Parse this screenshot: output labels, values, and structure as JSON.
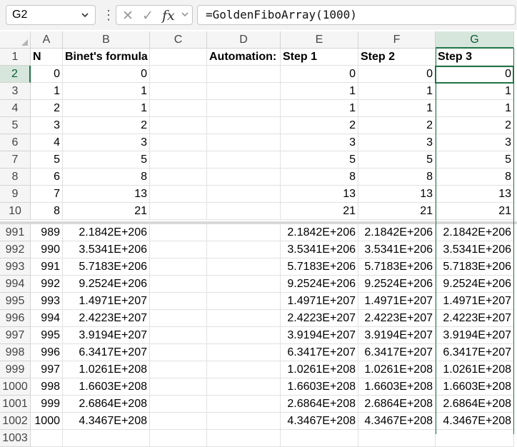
{
  "formula_bar": {
    "name_box": "G2",
    "cancel_glyph": "✕",
    "enter_glyph": "✓",
    "fx_label": "fx",
    "formula": "=GoldenFiboArray(1000)"
  },
  "icons": {
    "name_box_dropdown": "chevron-down-icon",
    "more_options": "vertical-dots-icon",
    "cancel": "close-icon",
    "enter": "check-icon",
    "insert_function": "fx-icon"
  },
  "colors": {
    "selection_green": "#217346",
    "header_bg": "#f5f5f5"
  },
  "columns": [
    "A",
    "B",
    "C",
    "D",
    "E",
    "F",
    "G"
  ],
  "selected_column": "G",
  "active_cell": "G2",
  "header_row": {
    "row": "1",
    "cells": [
      "N",
      "Binet's formula",
      "",
      "Automation:",
      "Step 1",
      "Step 2",
      "Step 3"
    ]
  },
  "top_rows": [
    {
      "row": "2",
      "cells": [
        "0",
        "0",
        "",
        "",
        "0",
        "0",
        "0"
      ]
    },
    {
      "row": "3",
      "cells": [
        "1",
        "1",
        "",
        "",
        "1",
        "1",
        "1"
      ]
    },
    {
      "row": "4",
      "cells": [
        "2",
        "1",
        "",
        "",
        "1",
        "1",
        "1"
      ]
    },
    {
      "row": "5",
      "cells": [
        "3",
        "2",
        "",
        "",
        "2",
        "2",
        "2"
      ]
    },
    {
      "row": "6",
      "cells": [
        "4",
        "3",
        "",
        "",
        "3",
        "3",
        "3"
      ]
    },
    {
      "row": "7",
      "cells": [
        "5",
        "5",
        "",
        "",
        "5",
        "5",
        "5"
      ]
    },
    {
      "row": "8",
      "cells": [
        "6",
        "8",
        "",
        "",
        "8",
        "8",
        "8"
      ]
    },
    {
      "row": "9",
      "cells": [
        "7",
        "13",
        "",
        "",
        "13",
        "13",
        "13"
      ]
    },
    {
      "row": "10",
      "cells": [
        "8",
        "21",
        "",
        "",
        "21",
        "21",
        "21"
      ]
    }
  ],
  "bottom_rows": [
    {
      "row": "991",
      "cells": [
        "989",
        "2.1842E+206",
        "",
        "",
        "2.1842E+206",
        "2.1842E+206",
        "2.1842E+206"
      ]
    },
    {
      "row": "992",
      "cells": [
        "990",
        "3.5341E+206",
        "",
        "",
        "3.5341E+206",
        "3.5341E+206",
        "3.5341E+206"
      ]
    },
    {
      "row": "993",
      "cells": [
        "991",
        "5.7183E+206",
        "",
        "",
        "5.7183E+206",
        "5.7183E+206",
        "5.7183E+206"
      ]
    },
    {
      "row": "994",
      "cells": [
        "992",
        "9.2524E+206",
        "",
        "",
        "9.2524E+206",
        "9.2524E+206",
        "9.2524E+206"
      ]
    },
    {
      "row": "995",
      "cells": [
        "993",
        "1.4971E+207",
        "",
        "",
        "1.4971E+207",
        "1.4971E+207",
        "1.4971E+207"
      ]
    },
    {
      "row": "996",
      "cells": [
        "994",
        "2.4223E+207",
        "",
        "",
        "2.4223E+207",
        "2.4223E+207",
        "2.4223E+207"
      ]
    },
    {
      "row": "997",
      "cells": [
        "995",
        "3.9194E+207",
        "",
        "",
        "3.9194E+207",
        "3.9194E+207",
        "3.9194E+207"
      ]
    },
    {
      "row": "998",
      "cells": [
        "996",
        "6.3417E+207",
        "",
        "",
        "6.3417E+207",
        "6.3417E+207",
        "6.3417E+207"
      ]
    },
    {
      "row": "999",
      "cells": [
        "997",
        "1.0261E+208",
        "",
        "",
        "1.0261E+208",
        "1.0261E+208",
        "1.0261E+208"
      ]
    },
    {
      "row": "1000",
      "cells": [
        "998",
        "1.6603E+208",
        "",
        "",
        "1.6603E+208",
        "1.6603E+208",
        "1.6603E+208"
      ]
    },
    {
      "row": "1001",
      "cells": [
        "999",
        "2.6864E+208",
        "",
        "",
        "2.6864E+208",
        "2.6864E+208",
        "2.6864E+208"
      ]
    },
    {
      "row": "1002",
      "cells": [
        "1000",
        "4.3467E+208",
        "",
        "",
        "4.3467E+208",
        "4.3467E+208",
        "4.3467E+208"
      ]
    },
    {
      "row": "1003",
      "cells": [
        "",
        "",
        "",
        "",
        "",
        "",
        ""
      ]
    }
  ]
}
